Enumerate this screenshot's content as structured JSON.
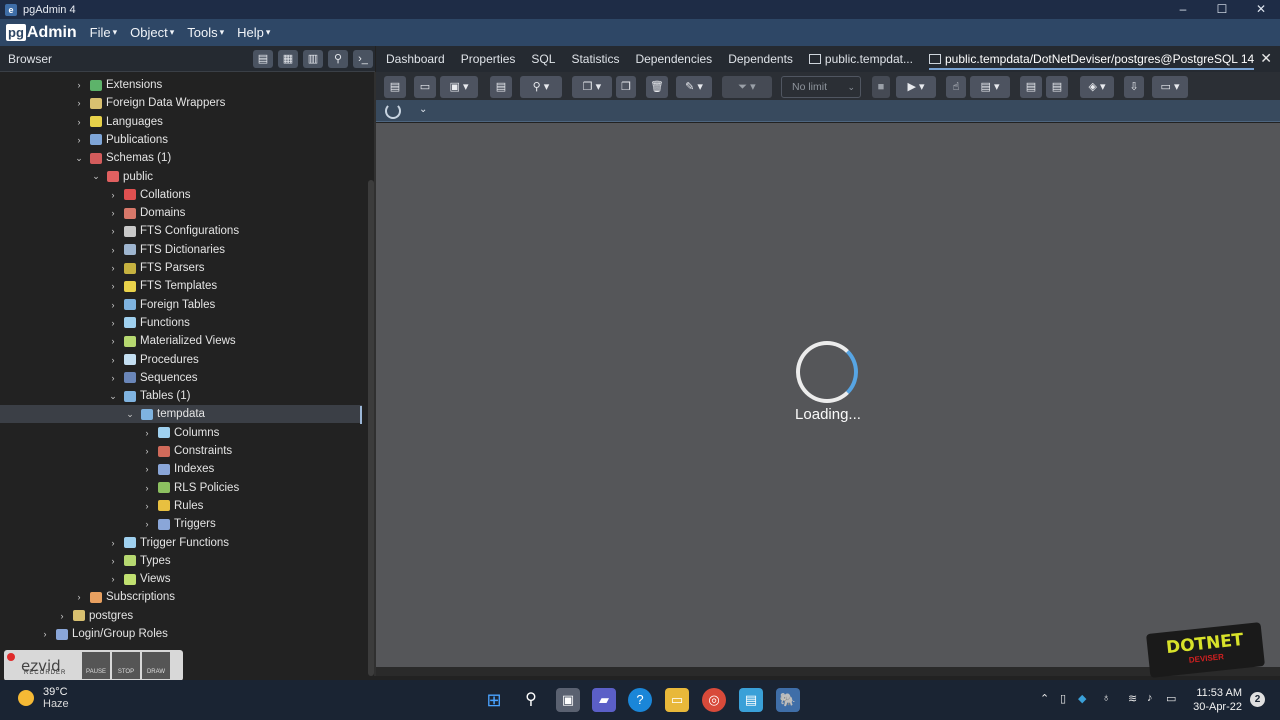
{
  "window": {
    "title": "pgAdmin 4",
    "minimize": "–",
    "maximize": "☐",
    "close": "✕"
  },
  "menubar": {
    "logo_pg": "pg",
    "logo_admin": "Admin",
    "menus": [
      "File",
      "Object",
      "Tools",
      "Help"
    ]
  },
  "browser": {
    "title": "Browser",
    "tree": [
      {
        "label": "Extensions",
        "icon_color": "#5db36a",
        "chevron": "›"
      },
      {
        "label": "Foreign Data Wrappers",
        "icon_color": "#d8c070",
        "chevron": "›"
      },
      {
        "label": "Languages",
        "icon_color": "#e8d24a",
        "chevron": "›"
      },
      {
        "label": "Publications",
        "icon_color": "#7fa6d8",
        "chevron": "›"
      },
      {
        "label": "Schemas (1)",
        "icon_color": "#d35c5c",
        "chevron": "⌄"
      },
      {
        "label": "public",
        "icon_color": "#e06060",
        "chevron": "⌄"
      },
      {
        "label": "Collations",
        "icon_color": "#e05050",
        "chevron": "›"
      },
      {
        "label": "Domains",
        "icon_color": "#d8786a",
        "chevron": "›"
      },
      {
        "label": "FTS Configurations",
        "icon_color": "#c9c9c9",
        "chevron": "›"
      },
      {
        "label": "FTS Dictionaries",
        "icon_color": "#9fb6d0",
        "chevron": "›"
      },
      {
        "label": "FTS Parsers",
        "icon_color": "#c6b240",
        "chevron": "›"
      },
      {
        "label": "FTS Templates",
        "icon_color": "#e8d24a",
        "chevron": "›"
      },
      {
        "label": "Foreign Tables",
        "icon_color": "#7fb3e0",
        "chevron": "›"
      },
      {
        "label": "Functions",
        "icon_color": "#9fd0ef",
        "chevron": "›"
      },
      {
        "label": "Materialized Views",
        "icon_color": "#b6d870",
        "chevron": "›"
      },
      {
        "label": "Procedures",
        "icon_color": "#c4dff2",
        "chevron": "›"
      },
      {
        "label": "Sequences",
        "icon_color": "#6a86b8",
        "chevron": "›"
      },
      {
        "label": "Tables (1)",
        "icon_color": "#7fb3e0",
        "chevron": "⌄"
      },
      {
        "label": "tempdata",
        "icon_color": "#7fb3e0",
        "chevron": "⌄"
      },
      {
        "label": "Columns",
        "icon_color": "#9fd0ef",
        "chevron": "›"
      },
      {
        "label": "Constraints",
        "icon_color": "#d06a5a",
        "chevron": "›"
      },
      {
        "label": "Indexes",
        "icon_color": "#8aa6d8",
        "chevron": "›"
      },
      {
        "label": "RLS Policies",
        "icon_color": "#8cc060",
        "chevron": "›"
      },
      {
        "label": "Rules",
        "icon_color": "#e8c040",
        "chevron": "›"
      },
      {
        "label": "Triggers",
        "icon_color": "#8aa6d8",
        "chevron": "›"
      },
      {
        "label": "Trigger Functions",
        "icon_color": "#9fd0ef",
        "chevron": "›"
      },
      {
        "label": "Types",
        "icon_color": "#b6d870",
        "chevron": "›"
      },
      {
        "label": "Views",
        "icon_color": "#c0e070",
        "chevron": "›"
      },
      {
        "label": "Subscriptions",
        "icon_color": "#e8a060",
        "chevron": "›"
      },
      {
        "label": "postgres",
        "icon_color": "#d8c070",
        "chevron": "›"
      },
      {
        "label": "Login/Group Roles",
        "icon_color": "#8aa6d8",
        "chevron": "›"
      }
    ]
  },
  "tabs": {
    "items": [
      "Dashboard",
      "Properties",
      "SQL",
      "Statistics",
      "Dependencies",
      "Dependents",
      "public.tempdat..."
    ],
    "active": "public.tempdata/DotNetDeviser/postgres@PostgreSQL 14",
    "close": "✕"
  },
  "toolbar": {
    "limit_value": "No limit",
    "limit_caret": "⌄"
  },
  "main": {
    "loading_text": "Loading..."
  },
  "ezvid": {
    "brand": "ezvid",
    "sub": "RECORDER",
    "buttons": [
      "PAUSE",
      "STOP",
      "DRAW"
    ]
  },
  "watermark": {
    "line1": "DOTNET",
    "line2": "DEVISER"
  },
  "taskbar": {
    "temperature": "39°C",
    "weather": "Haze",
    "time": "11:53 AM",
    "date": "30-Apr-22",
    "notifications": "2"
  }
}
